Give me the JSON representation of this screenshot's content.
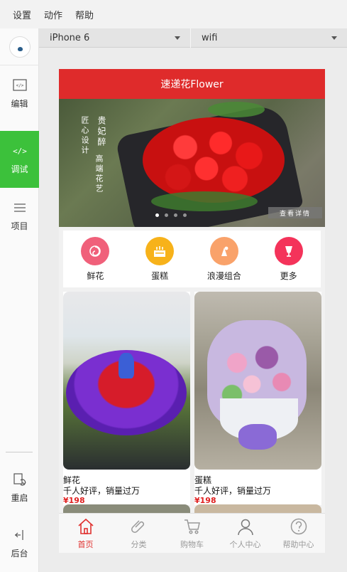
{
  "menubar": {
    "items": [
      "设置",
      "动作",
      "帮助"
    ]
  },
  "sidebar": {
    "items": [
      {
        "label": "编辑",
        "icon": "code-icon"
      },
      {
        "label": "调试",
        "icon": "code-icon",
        "active": true
      },
      {
        "label": "项目",
        "icon": "menu-icon"
      },
      {
        "label": "重启",
        "icon": "restart-icon"
      },
      {
        "label": "后台",
        "icon": "background-icon"
      }
    ]
  },
  "device": {
    "model": "iPhone 6",
    "network": "wifi"
  },
  "app": {
    "title": "速递花Flower",
    "banner": {
      "poem_left": "匠心设计",
      "poem_left2": "高端花艺",
      "poem_right": "贵妃醉",
      "detail_label": "查看详情"
    },
    "categories": [
      {
        "label": "鲜花",
        "color": "#f0607a",
        "icon": "flower-icon"
      },
      {
        "label": "蛋糕",
        "color": "#f7b21a",
        "icon": "cake-icon"
      },
      {
        "label": "浪漫组合",
        "color": "#f9a26a",
        "icon": "gift-icon"
      },
      {
        "label": "更多",
        "color": "#f4335a",
        "icon": "cup-icon"
      }
    ],
    "products": [
      {
        "name": "鲜花",
        "desc": "千人好评，销量过万",
        "price": "¥198"
      },
      {
        "name": "蛋糕",
        "desc": "千人好评，销量过万",
        "price": "¥198"
      }
    ],
    "tabs": [
      {
        "label": "首页",
        "icon": "home-icon",
        "active": true
      },
      {
        "label": "分类",
        "icon": "paperclip-icon"
      },
      {
        "label": "购物车",
        "icon": "cart-icon"
      },
      {
        "label": "个人中心",
        "icon": "user-icon"
      },
      {
        "label": "帮助中心",
        "icon": "help-icon"
      }
    ]
  },
  "colors": {
    "accent": "#df2b2b",
    "sidebar_active": "#3cc13b"
  }
}
